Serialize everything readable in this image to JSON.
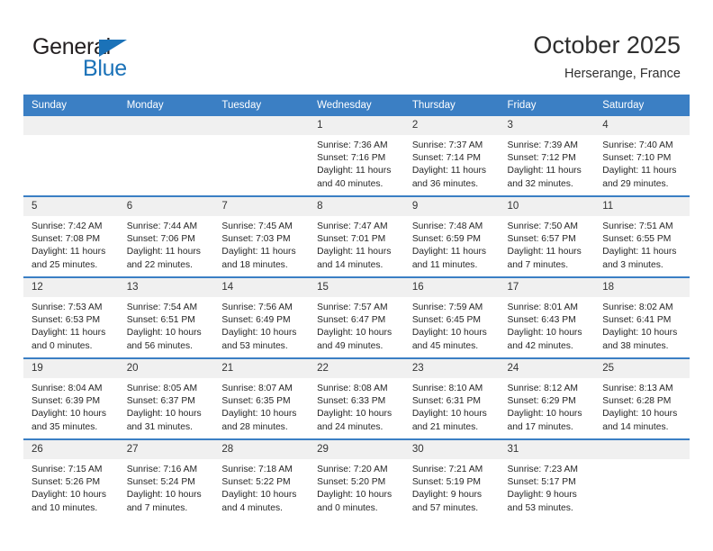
{
  "logo": {
    "word_one": "General",
    "word_two": "Blue",
    "triangle_color": "#1b72b8"
  },
  "header": {
    "title": "October 2025",
    "location": "Herserange, France"
  },
  "theme": {
    "header_blue": "#3b7fc4",
    "daynum_bg": "#f0f0f0",
    "text": "#262626"
  },
  "calendar": {
    "weekday_headers": [
      "Sunday",
      "Monday",
      "Tuesday",
      "Wednesday",
      "Thursday",
      "Friday",
      "Saturday"
    ],
    "weeks": [
      [
        {
          "day": "",
          "empty": true
        },
        {
          "day": "",
          "empty": true
        },
        {
          "day": "",
          "empty": true
        },
        {
          "day": "1",
          "sunrise": "Sunrise: 7:36 AM",
          "sunset": "Sunset: 7:16 PM",
          "daylight_1": "Daylight: 11 hours",
          "daylight_2": "and 40 minutes."
        },
        {
          "day": "2",
          "sunrise": "Sunrise: 7:37 AM",
          "sunset": "Sunset: 7:14 PM",
          "daylight_1": "Daylight: 11 hours",
          "daylight_2": "and 36 minutes."
        },
        {
          "day": "3",
          "sunrise": "Sunrise: 7:39 AM",
          "sunset": "Sunset: 7:12 PM",
          "daylight_1": "Daylight: 11 hours",
          "daylight_2": "and 32 minutes."
        },
        {
          "day": "4",
          "sunrise": "Sunrise: 7:40 AM",
          "sunset": "Sunset: 7:10 PM",
          "daylight_1": "Daylight: 11 hours",
          "daylight_2": "and 29 minutes."
        }
      ],
      [
        {
          "day": "5",
          "sunrise": "Sunrise: 7:42 AM",
          "sunset": "Sunset: 7:08 PM",
          "daylight_1": "Daylight: 11 hours",
          "daylight_2": "and 25 minutes."
        },
        {
          "day": "6",
          "sunrise": "Sunrise: 7:44 AM",
          "sunset": "Sunset: 7:06 PM",
          "daylight_1": "Daylight: 11 hours",
          "daylight_2": "and 22 minutes."
        },
        {
          "day": "7",
          "sunrise": "Sunrise: 7:45 AM",
          "sunset": "Sunset: 7:03 PM",
          "daylight_1": "Daylight: 11 hours",
          "daylight_2": "and 18 minutes."
        },
        {
          "day": "8",
          "sunrise": "Sunrise: 7:47 AM",
          "sunset": "Sunset: 7:01 PM",
          "daylight_1": "Daylight: 11 hours",
          "daylight_2": "and 14 minutes."
        },
        {
          "day": "9",
          "sunrise": "Sunrise: 7:48 AM",
          "sunset": "Sunset: 6:59 PM",
          "daylight_1": "Daylight: 11 hours",
          "daylight_2": "and 11 minutes."
        },
        {
          "day": "10",
          "sunrise": "Sunrise: 7:50 AM",
          "sunset": "Sunset: 6:57 PM",
          "daylight_1": "Daylight: 11 hours",
          "daylight_2": "and 7 minutes."
        },
        {
          "day": "11",
          "sunrise": "Sunrise: 7:51 AM",
          "sunset": "Sunset: 6:55 PM",
          "daylight_1": "Daylight: 11 hours",
          "daylight_2": "and 3 minutes."
        }
      ],
      [
        {
          "day": "12",
          "sunrise": "Sunrise: 7:53 AM",
          "sunset": "Sunset: 6:53 PM",
          "daylight_1": "Daylight: 11 hours",
          "daylight_2": "and 0 minutes."
        },
        {
          "day": "13",
          "sunrise": "Sunrise: 7:54 AM",
          "sunset": "Sunset: 6:51 PM",
          "daylight_1": "Daylight: 10 hours",
          "daylight_2": "and 56 minutes."
        },
        {
          "day": "14",
          "sunrise": "Sunrise: 7:56 AM",
          "sunset": "Sunset: 6:49 PM",
          "daylight_1": "Daylight: 10 hours",
          "daylight_2": "and 53 minutes."
        },
        {
          "day": "15",
          "sunrise": "Sunrise: 7:57 AM",
          "sunset": "Sunset: 6:47 PM",
          "daylight_1": "Daylight: 10 hours",
          "daylight_2": "and 49 minutes."
        },
        {
          "day": "16",
          "sunrise": "Sunrise: 7:59 AM",
          "sunset": "Sunset: 6:45 PM",
          "daylight_1": "Daylight: 10 hours",
          "daylight_2": "and 45 minutes."
        },
        {
          "day": "17",
          "sunrise": "Sunrise: 8:01 AM",
          "sunset": "Sunset: 6:43 PM",
          "daylight_1": "Daylight: 10 hours",
          "daylight_2": "and 42 minutes."
        },
        {
          "day": "18",
          "sunrise": "Sunrise: 8:02 AM",
          "sunset": "Sunset: 6:41 PM",
          "daylight_1": "Daylight: 10 hours",
          "daylight_2": "and 38 minutes."
        }
      ],
      [
        {
          "day": "19",
          "sunrise": "Sunrise: 8:04 AM",
          "sunset": "Sunset: 6:39 PM",
          "daylight_1": "Daylight: 10 hours",
          "daylight_2": "and 35 minutes."
        },
        {
          "day": "20",
          "sunrise": "Sunrise: 8:05 AM",
          "sunset": "Sunset: 6:37 PM",
          "daylight_1": "Daylight: 10 hours",
          "daylight_2": "and 31 minutes."
        },
        {
          "day": "21",
          "sunrise": "Sunrise: 8:07 AM",
          "sunset": "Sunset: 6:35 PM",
          "daylight_1": "Daylight: 10 hours",
          "daylight_2": "and 28 minutes."
        },
        {
          "day": "22",
          "sunrise": "Sunrise: 8:08 AM",
          "sunset": "Sunset: 6:33 PM",
          "daylight_1": "Daylight: 10 hours",
          "daylight_2": "and 24 minutes."
        },
        {
          "day": "23",
          "sunrise": "Sunrise: 8:10 AM",
          "sunset": "Sunset: 6:31 PM",
          "daylight_1": "Daylight: 10 hours",
          "daylight_2": "and 21 minutes."
        },
        {
          "day": "24",
          "sunrise": "Sunrise: 8:12 AM",
          "sunset": "Sunset: 6:29 PM",
          "daylight_1": "Daylight: 10 hours",
          "daylight_2": "and 17 minutes."
        },
        {
          "day": "25",
          "sunrise": "Sunrise: 8:13 AM",
          "sunset": "Sunset: 6:28 PM",
          "daylight_1": "Daylight: 10 hours",
          "daylight_2": "and 14 minutes."
        }
      ],
      [
        {
          "day": "26",
          "sunrise": "Sunrise: 7:15 AM",
          "sunset": "Sunset: 5:26 PM",
          "daylight_1": "Daylight: 10 hours",
          "daylight_2": "and 10 minutes."
        },
        {
          "day": "27",
          "sunrise": "Sunrise: 7:16 AM",
          "sunset": "Sunset: 5:24 PM",
          "daylight_1": "Daylight: 10 hours",
          "daylight_2": "and 7 minutes."
        },
        {
          "day": "28",
          "sunrise": "Sunrise: 7:18 AM",
          "sunset": "Sunset: 5:22 PM",
          "daylight_1": "Daylight: 10 hours",
          "daylight_2": "and 4 minutes."
        },
        {
          "day": "29",
          "sunrise": "Sunrise: 7:20 AM",
          "sunset": "Sunset: 5:20 PM",
          "daylight_1": "Daylight: 10 hours",
          "daylight_2": "and 0 minutes."
        },
        {
          "day": "30",
          "sunrise": "Sunrise: 7:21 AM",
          "sunset": "Sunset: 5:19 PM",
          "daylight_1": "Daylight: 9 hours",
          "daylight_2": "and 57 minutes."
        },
        {
          "day": "31",
          "sunrise": "Sunrise: 7:23 AM",
          "sunset": "Sunset: 5:17 PM",
          "daylight_1": "Daylight: 9 hours",
          "daylight_2": "and 53 minutes."
        },
        {
          "day": "",
          "empty": true
        }
      ]
    ]
  }
}
